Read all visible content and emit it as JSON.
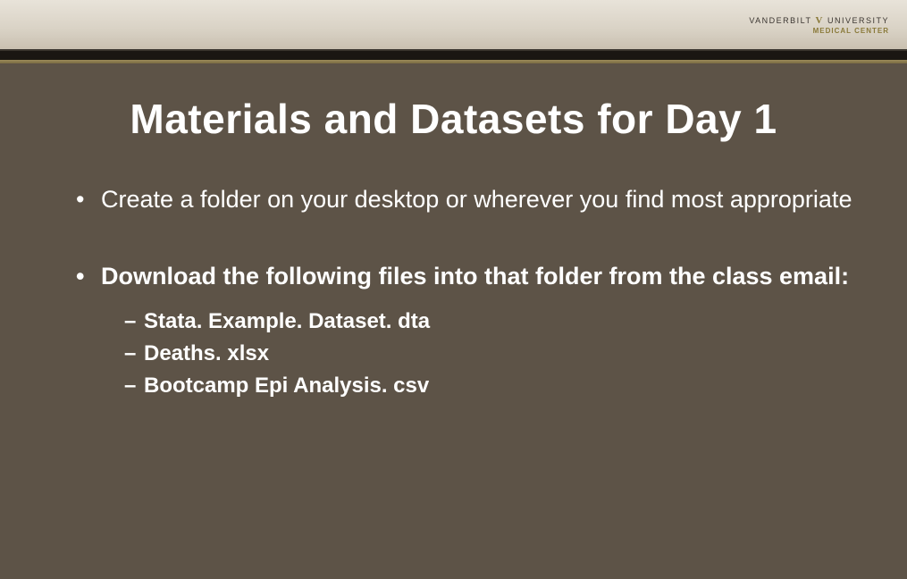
{
  "header": {
    "logo_line1a": "VANDERBILT",
    "logo_v": "V",
    "logo_line1b": "UNIVERSITY",
    "logo_line2": "MEDICAL CENTER"
  },
  "slide": {
    "title": "Materials and Datasets for Day 1",
    "bullets": [
      {
        "text": "Create a folder on your desktop or wherever you find most appropriate",
        "bold": false,
        "subs": []
      },
      {
        "text": "Download the following files into that folder from the class email:",
        "bold": true,
        "subs": [
          "Stata. Example. Dataset. dta",
          "Deaths. xlsx",
          "Bootcamp Epi Analysis. csv"
        ]
      }
    ]
  }
}
